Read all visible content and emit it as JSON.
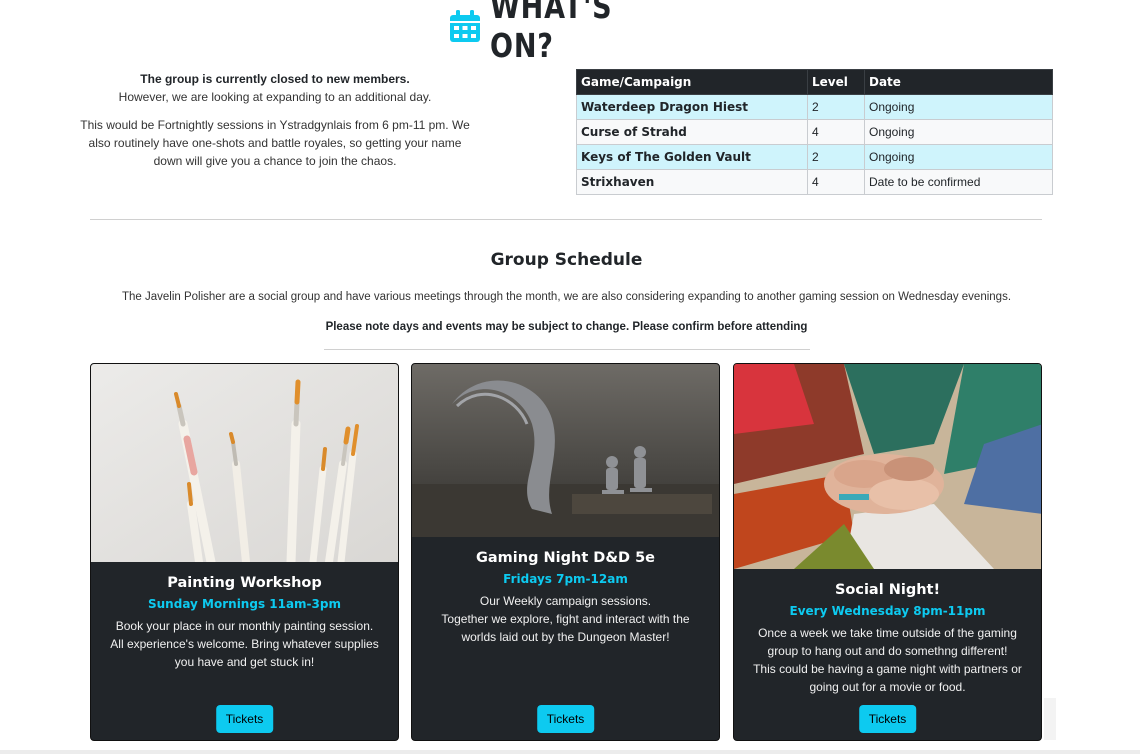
{
  "header": {
    "title": "WHAT'S ON?",
    "icon": "calendar-icon",
    "icon_color": "#0dcaf0"
  },
  "intro": {
    "closed_line": "The group is currently closed to new members.",
    "expanding_line": "However, we are looking at expanding to an additional day.",
    "details": "This would be Fortnightly sessions in Ystradgynlais from 6 pm-11 pm. We also routinely have one-shots and battle royales, so getting your name down will give you a chance to join the chaos."
  },
  "campaigns": {
    "headers": [
      "Game/Campaign",
      "Level",
      "Date"
    ],
    "rows": [
      {
        "name": "Waterdeep Dragon Hiest",
        "level": "2",
        "date": "Ongoing"
      },
      {
        "name": "Curse of Strahd",
        "level": "4",
        "date": "Ongoing"
      },
      {
        "name": "Keys of The Golden Vault",
        "level": "2",
        "date": "Ongoing"
      },
      {
        "name": "Strixhaven",
        "level": "4",
        "date": "Date to be confirmed"
      }
    ]
  },
  "schedule": {
    "title": "Group Schedule",
    "description": "The Javelin Polisher are a social group and have various meetings through the month, we are also considering expanding to another gaming session on Wednesday evenings.",
    "note": "Please note days and events may be subject to change. Please confirm before attending"
  },
  "cards": [
    {
      "title": "Painting Workshop",
      "when": "Sunday Mornings 11am-3pm",
      "text": "Book your place in our monthly painting session.\nAll experience's welcome. Bring whatever supplies you have and get stuck in!",
      "button": "Tickets"
    },
    {
      "title": "Gaming Night D&D 5e",
      "when": "Fridays 7pm-12am",
      "text": "Our Weekly campaign sessions.\nTogether we explore, fight and interact with the worlds laid out by the Dungeon Master!",
      "button": "Tickets"
    },
    {
      "title": "Social Night!",
      "when": "Every Wednesday 8pm-11pm",
      "text": "Once a week we take time outside of the gaming group to hang out and do somethng different!\nThis could be having a game night with partners or going out for a movie or food.",
      "button": "Tickets"
    }
  ],
  "colors": {
    "accent": "#0dcaf0",
    "dark": "#212529",
    "row_highlight": "#cff4fc"
  }
}
